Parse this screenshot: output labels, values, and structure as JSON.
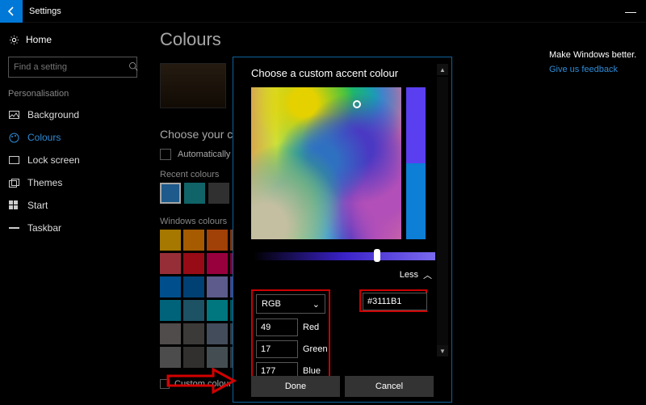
{
  "header": {
    "title": "Settings"
  },
  "sidebar": {
    "home": "Home",
    "search_placeholder": "Find a setting",
    "section": "Personalisation",
    "items": [
      {
        "label": "Background"
      },
      {
        "label": "Colours"
      },
      {
        "label": "Lock screen"
      },
      {
        "label": "Themes"
      },
      {
        "label": "Start"
      },
      {
        "label": "Taskbar"
      }
    ]
  },
  "content": {
    "title": "Colours",
    "section_choose": "Choose your colour",
    "auto_pick": "Automatically pick an accent colour from my background",
    "recent_label": "Recent colours",
    "recent_swatches": [
      "#2e8bd6",
      "#1a9aa0",
      "#4b4b4b",
      "#c43131"
    ],
    "windows_label": "Windows colours",
    "windows_swatches": [
      "#ffb900",
      "#ff8c00",
      "#f7630c",
      "#ca5010",
      "#da3b01",
      "#ef6950",
      "#d13438",
      "#ff4343",
      "#e74856",
      "#e81123",
      "#ea005e",
      "#c30052",
      "#e3008c",
      "#bf0077",
      "#c239b3",
      "#9a0089",
      "#0078d7",
      "#0063b1",
      "#8e8cd8",
      "#6b69d6",
      "#8764b8",
      "#744da9",
      "#b146c2",
      "#881798",
      "#0099bc",
      "#2d7d9a",
      "#00b7c3",
      "#038387",
      "#00b294",
      "#018574",
      "#00cc6a",
      "#10893e",
      "#7a7574",
      "#5d5a58",
      "#68768a",
      "#515c6b",
      "#567c73",
      "#486860",
      "#498205",
      "#107c10",
      "#767676",
      "#4c4a48",
      "#69797e",
      "#4a5459",
      "#647c64",
      "#525e54",
      "#847545",
      "#7e735f"
    ],
    "custom_colour": "Custom colour"
  },
  "right": {
    "make_better": "Make Windows better.",
    "feedback": "Give us feedback"
  },
  "modal": {
    "title": "Choose a custom accent colour",
    "less": "Less",
    "mode": "RGB",
    "r_label": "Red",
    "g_label": "Green",
    "b_label": "Blue",
    "r": "49",
    "g": "17",
    "b": "177",
    "hex": "#3111B1",
    "done": "Done",
    "cancel": "Cancel"
  }
}
